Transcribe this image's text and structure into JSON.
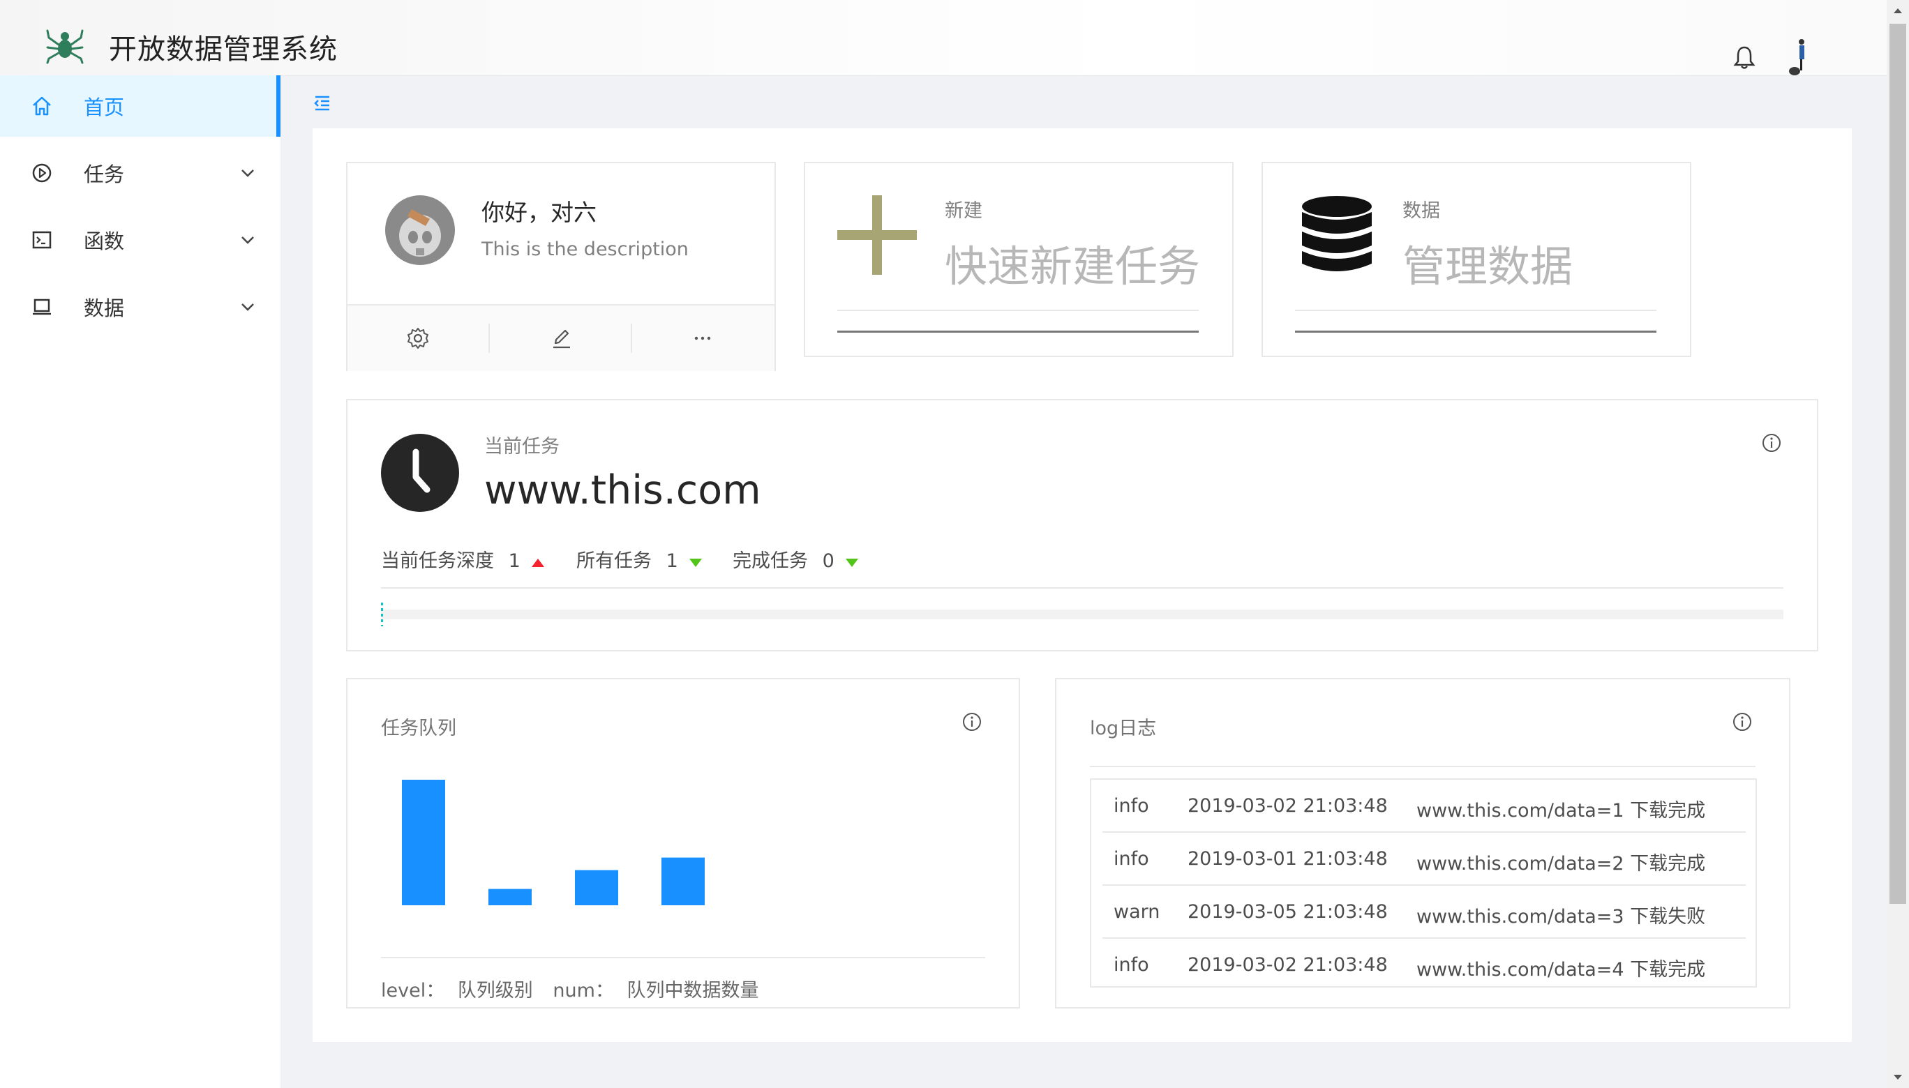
{
  "header": {
    "title": "开放数据管理系统"
  },
  "sidebar": {
    "items": [
      {
        "label": "首页",
        "icon": "home-icon",
        "active": true
      },
      {
        "label": "任务",
        "icon": "play-circle-icon"
      },
      {
        "label": "函数",
        "icon": "code-icon"
      },
      {
        "label": "数据",
        "icon": "laptop-icon"
      }
    ]
  },
  "profile": {
    "greeting": "你好，对六",
    "description": "This is the description"
  },
  "quick_new": {
    "label": "新建",
    "title": "快速新建任务"
  },
  "manage_data": {
    "label": "数据",
    "title": "管理数据"
  },
  "current_task": {
    "label": "当前任务",
    "url": "www.this.com",
    "stats": [
      {
        "label": "当前任务深度",
        "value": "1",
        "trend": "up"
      },
      {
        "label": "所有任务",
        "value": "1",
        "trend": "down"
      },
      {
        "label": "完成任务",
        "value": "0",
        "trend": "down"
      }
    ],
    "progress": 0.0
  },
  "queue": {
    "title": "任务队列",
    "legend_level_key": "level：",
    "legend_level_value": "队列级别",
    "legend_num_key": "num：",
    "legend_num_value": "队列中数据数量"
  },
  "chart_data": {
    "type": "bar",
    "values": [
      100,
      13,
      28,
      38
    ],
    "ylim": [
      0,
      100
    ],
    "color": "#1890ff"
  },
  "log": {
    "title": "log日志",
    "rows": [
      {
        "level": "info",
        "time": "2019-03-02 21:03:48",
        "msg": "www.this.com/data=1 下载完成"
      },
      {
        "level": "info",
        "time": "2019-03-01 21:03:48",
        "msg": "www.this.com/data=2 下载完成"
      },
      {
        "level": "warn",
        "time": "2019-03-05 21:03:48",
        "msg": "www.this.com/data=3 下载失败"
      },
      {
        "level": "info",
        "time": "2019-03-02 21:03:48",
        "msg": "www.this.com/data=4 下载完成"
      }
    ]
  },
  "colors": {
    "primary": "#1890ff",
    "up": "#f5222d",
    "down": "#52c41a",
    "plus": "#a8a574"
  }
}
